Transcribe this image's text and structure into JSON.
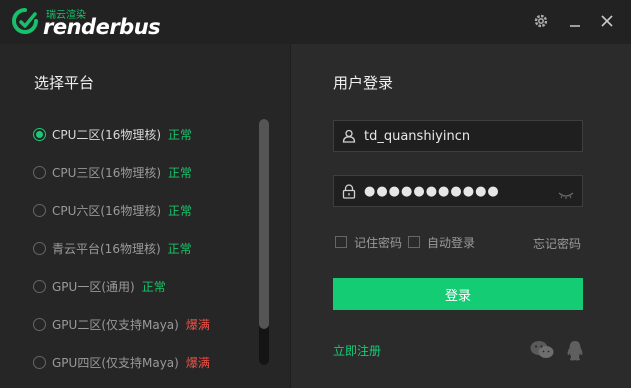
{
  "app": {
    "logo_subtitle": "瑞云渲染",
    "logo_name": "renderbus"
  },
  "left_panel": {
    "title": "选择平台",
    "platforms": [
      {
        "name": "CPU二区(16物理核)",
        "status": "正常",
        "status_color": "#19c36a",
        "selected": true
      },
      {
        "name": "CPU三区(16物理核)",
        "status": "正常",
        "status_color": "#19c36a",
        "selected": false
      },
      {
        "name": "CPU六区(16物理核)",
        "status": "正常",
        "status_color": "#19c36a",
        "selected": false
      },
      {
        "name": "青云平台(16物理核)",
        "status": "正常",
        "status_color": "#19c36a",
        "selected": false
      },
      {
        "name": "GPU一区(通用)",
        "status": "正常",
        "status_color": "#19c36a",
        "selected": false
      },
      {
        "name": "GPU二区(仅支持Maya)",
        "status": "爆满",
        "status_color": "#e8534a",
        "selected": false
      },
      {
        "name": "GPU四区(仅支持Maya)",
        "status": "爆满",
        "status_color": "#e8534a",
        "selected": false
      }
    ]
  },
  "right_panel": {
    "title": "用户登录",
    "username": "td_quanshiyincn",
    "password_masked": "●●●●●●●●●●●",
    "remember_password": "记住密码",
    "auto_login": "自动登录",
    "forgot_password": "忘记密码",
    "login_button": "登录",
    "register_link": "立即注册"
  },
  "icons": {
    "settings": "gear-icon",
    "minimize": "minimize-icon",
    "close": "close-icon",
    "user": "user-icon",
    "lock": "lock-icon",
    "eye": "eye-closed-icon",
    "wechat": "wechat-icon",
    "qq": "qq-icon"
  },
  "colors": {
    "accent": "#14cc74",
    "ok": "#19c36a",
    "full": "#e8534a"
  }
}
